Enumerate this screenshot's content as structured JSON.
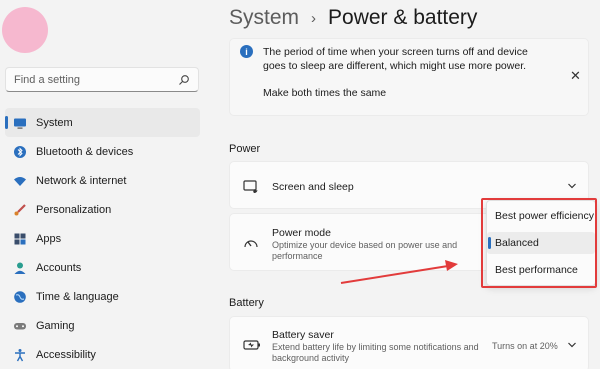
{
  "sidebar": {
    "search_placeholder": "Find a setting",
    "items": [
      {
        "label": "System",
        "icon": "monitor-icon"
      },
      {
        "label": "Bluetooth & devices",
        "icon": "bluetooth-icon"
      },
      {
        "label": "Network & internet",
        "icon": "wifi-icon"
      },
      {
        "label": "Personalization",
        "icon": "brush-icon"
      },
      {
        "label": "Apps",
        "icon": "apps-icon"
      },
      {
        "label": "Accounts",
        "icon": "person-icon"
      },
      {
        "label": "Time & language",
        "icon": "globe-icon"
      },
      {
        "label": "Gaming",
        "icon": "gamepad-icon"
      },
      {
        "label": "Accessibility",
        "icon": "accessibility-icon"
      }
    ]
  },
  "breadcrumb": {
    "parent": "System",
    "separator": "›",
    "current": "Power & battery"
  },
  "info": {
    "text": "The period of time when your screen turns off and device goes to sleep are different, which might use more power.",
    "action": "Make both times the same",
    "close_glyph": "✕"
  },
  "power": {
    "section_label": "Power",
    "screen_sleep": {
      "title": "Screen and sleep"
    },
    "power_mode": {
      "title": "Power mode",
      "subtitle": "Optimize your device based on power use and performance"
    },
    "dropdown": {
      "options": [
        "Best power efficiency",
        "Balanced",
        "Best performance"
      ],
      "selected": "Balanced"
    }
  },
  "battery": {
    "section_label": "Battery",
    "saver": {
      "title": "Battery saver",
      "subtitle": "Extend battery life by limiting some notifications and background activity",
      "status": "Turns on at 20%"
    }
  },
  "colors": {
    "accent": "#2a6fbe",
    "annotation": "#e23b3b",
    "avatar": "#f6b8cf"
  }
}
